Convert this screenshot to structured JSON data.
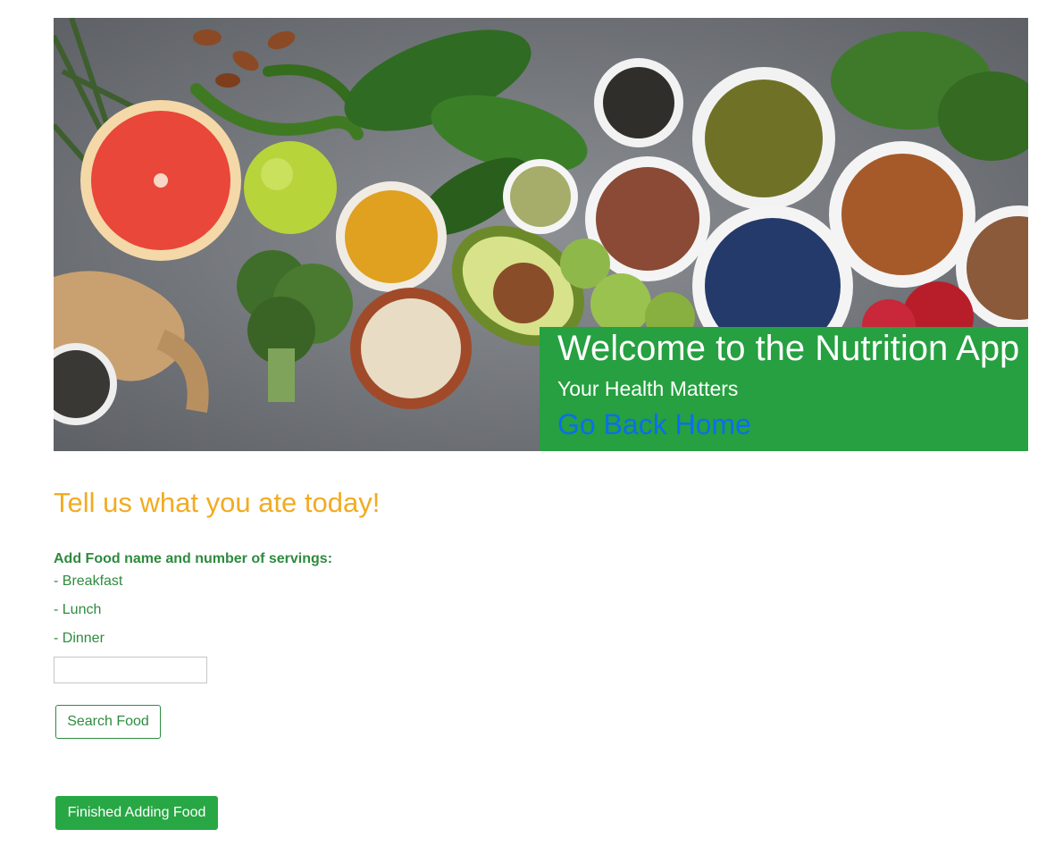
{
  "hero": {
    "title": "Welcome to the Nutrition App",
    "subtitle": "Your Health Matters",
    "home_link": "Go Back Home",
    "image_icon": "vegetables-banner-image"
  },
  "main": {
    "heading": "Tell us what you ate today!",
    "instruction": "Add Food name and number of servings:",
    "meals": [
      "- Breakfast",
      "- Lunch",
      "- Dinner"
    ],
    "food_input": {
      "value": "",
      "placeholder": ""
    },
    "search_button": "Search Food",
    "finish_button": "Finished Adding Food"
  },
  "colors": {
    "banner_box": "#26a040",
    "heading": "#f2ab22",
    "text_green": "#2e8b3f",
    "link_blue": "#0a6ef0",
    "button_green": "#28a745"
  }
}
